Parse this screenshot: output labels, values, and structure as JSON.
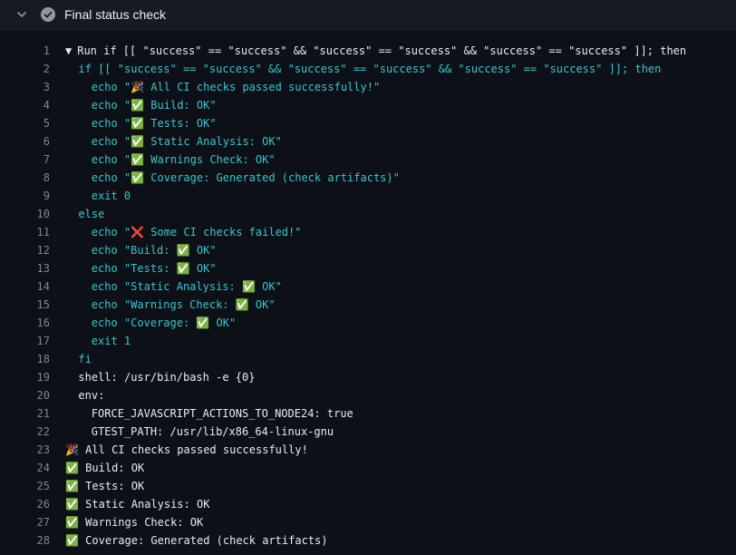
{
  "header": {
    "title": "Final status check",
    "status_icon": "check-circle-icon",
    "toggle_icon": "chevron-down-icon"
  },
  "log": {
    "lines": [
      {
        "n": "1",
        "text": "Run if [[ \"success\" == \"success\" && \"success\" == \"success\" && \"success\" == \"success\" ]]; then",
        "style": "group",
        "indent": 0,
        "toggle": "▼"
      },
      {
        "n": "2",
        "text": "if [[ \"success\" == \"success\" && \"success\" == \"success\" && \"success\" == \"success\" ]]; then",
        "style": "cmd",
        "indent": 2
      },
      {
        "n": "3",
        "text": "echo \"🎉 All CI checks passed successfully!\"",
        "style": "cmd",
        "indent": 4
      },
      {
        "n": "4",
        "text": "echo \"✅ Build: OK\"",
        "style": "cmd",
        "indent": 4
      },
      {
        "n": "5",
        "text": "echo \"✅ Tests: OK\"",
        "style": "cmd",
        "indent": 4
      },
      {
        "n": "6",
        "text": "echo \"✅ Static Analysis: OK\"",
        "style": "cmd",
        "indent": 4
      },
      {
        "n": "7",
        "text": "echo \"✅ Warnings Check: OK\"",
        "style": "cmd",
        "indent": 4
      },
      {
        "n": "8",
        "text": "echo \"✅ Coverage: Generated (check artifacts)\"",
        "style": "cmd",
        "indent": 4
      },
      {
        "n": "9",
        "text": "exit 0",
        "style": "cmd",
        "indent": 4
      },
      {
        "n": "10",
        "text": "else",
        "style": "cmd",
        "indent": 2
      },
      {
        "n": "11",
        "text": "echo \"❌ Some CI checks failed!\"",
        "style": "cmd",
        "indent": 4
      },
      {
        "n": "12",
        "text": "echo \"Build: ✅ OK\"",
        "style": "cmd",
        "indent": 4
      },
      {
        "n": "13",
        "text": "echo \"Tests: ✅ OK\"",
        "style": "cmd",
        "indent": 4
      },
      {
        "n": "14",
        "text": "echo \"Static Analysis: ✅ OK\"",
        "style": "cmd",
        "indent": 4
      },
      {
        "n": "15",
        "text": "echo \"Warnings Check: ✅ OK\"",
        "style": "cmd",
        "indent": 4
      },
      {
        "n": "16",
        "text": "echo \"Coverage: ✅ OK\"",
        "style": "cmd",
        "indent": 4
      },
      {
        "n": "17",
        "text": "exit 1",
        "style": "cmd",
        "indent": 4
      },
      {
        "n": "18",
        "text": "fi",
        "style": "cmd",
        "indent": 2
      },
      {
        "n": "19",
        "text": "shell: /usr/bin/bash -e {0}",
        "style": "out",
        "indent": 2
      },
      {
        "n": "20",
        "text": "env:",
        "style": "out",
        "indent": 2
      },
      {
        "n": "21",
        "text": "FORCE_JAVASCRIPT_ACTIONS_TO_NODE24: true",
        "style": "out",
        "indent": 4
      },
      {
        "n": "22",
        "text": "GTEST_PATH: /usr/lib/x86_64-linux-gnu",
        "style": "out",
        "indent": 4
      },
      {
        "n": "23",
        "text": "🎉 All CI checks passed successfully!",
        "style": "out",
        "indent": 0
      },
      {
        "n": "24",
        "text": "✅ Build: OK",
        "style": "out",
        "indent": 0
      },
      {
        "n": "25",
        "text": "✅ Tests: OK",
        "style": "out",
        "indent": 0
      },
      {
        "n": "26",
        "text": "✅ Static Analysis: OK",
        "style": "out",
        "indent": 0
      },
      {
        "n": "27",
        "text": "✅ Warnings Check: OK",
        "style": "out",
        "indent": 0
      },
      {
        "n": "28",
        "text": "✅ Coverage: Generated (check artifacts)",
        "style": "out",
        "indent": 0
      }
    ]
  },
  "colors": {
    "background": "#0d1117",
    "command": "#39c5cf",
    "output": "#e6edf3",
    "line_number": "#7d8590"
  }
}
